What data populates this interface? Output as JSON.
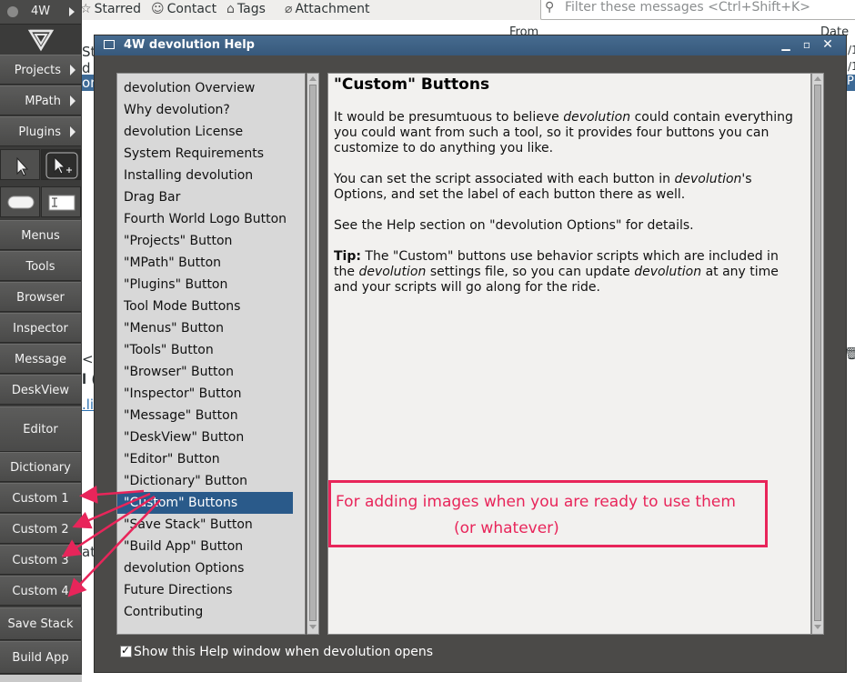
{
  "background": {
    "toolbar_items": [
      {
        "icon": "star-icon",
        "glyph": "☆",
        "label": "Starred"
      },
      {
        "icon": "contact-icon",
        "glyph": "☺",
        "label": "Contact"
      },
      {
        "icon": "tag-icon",
        "glyph": "⌂",
        "label": "Tags"
      },
      {
        "icon": "paperclip-icon",
        "glyph": "⌀",
        "label": "Attachment"
      }
    ],
    "filter_placeholder": "Filter these messages <Ctrl+Shift+K>",
    "column_from": "From",
    "column_date": "Date",
    "fragments": [
      "St",
      "d t",
      "on",
      "<:",
      "l (",
      ".li",
      "at",
      "P",
      "/1",
      "/1"
    ]
  },
  "sidebar": {
    "app_label": "4W",
    "menus": [
      "Projects",
      "MPath",
      "Plugins"
    ],
    "buttons": [
      "Menus",
      "Tools",
      "Browser",
      "Inspector",
      "Message",
      "DeskView"
    ],
    "editor": "Editor",
    "lower_buttons": [
      "Dictionary",
      "Custom 1",
      "Custom 2",
      "Custom 3",
      "Custom 4"
    ],
    "save_stack": "Save Stack",
    "build_app": "Build App"
  },
  "help": {
    "title": "4W devolution Help",
    "topics": [
      "devolution Overview",
      "Why devolution?",
      "devolution License",
      "System Requirements",
      "Installing devolution",
      "Drag Bar",
      "Fourth World Logo Button",
      "\"Projects\" Button",
      "\"MPath\" Button",
      "\"Plugins\" Button",
      "Tool Mode Buttons",
      "\"Menus\" Button",
      "\"Tools\" Button",
      "\"Browser\" Button",
      "\"Inspector\" Button",
      "\"Message\" Button",
      "\"DeskView\" Button",
      "\"Editor\" Button",
      "\"Dictionary\" Button",
      "\"Custom\" Buttons",
      "\"Save Stack\" Button",
      "\"Build App\" Button",
      "devolution Options",
      "Future Directions",
      "Contributing"
    ],
    "selected_index": 19,
    "content": {
      "title": "\"Custom\" Buttons",
      "p1_a": "It would be presumtuous to believe ",
      "p1_em": "devolution",
      "p1_b": " could contain everything you could want from such a tool, so it provides four buttons you can customize to do anything you like.",
      "p2_a": "You can set the script associated with each button in ",
      "p2_em": "devolution",
      "p2_b": "'s Options, and set the label of each button there as well.",
      "p3": "See the Help section on \"devolution Options\" for details.",
      "tip_label": "Tip:",
      "tip_a": "  The \"Custom\" buttons use behavior scripts which are included in the ",
      "tip_em1": "devolution",
      "tip_b": " settings file, so you can update ",
      "tip_em2": "devolution",
      "tip_c": " at any time and your scripts will go along for the ride."
    },
    "annotation_line1": "For adding images when you are ready to use them",
    "annotation_line2": "(or whatever)",
    "show_help_label": "Show this Help window when devolution opens",
    "show_help_checked": "✓"
  },
  "colors": {
    "annotation": "#e8255a",
    "selection": "#2a5a8a",
    "titlebar": "#3d6185"
  }
}
